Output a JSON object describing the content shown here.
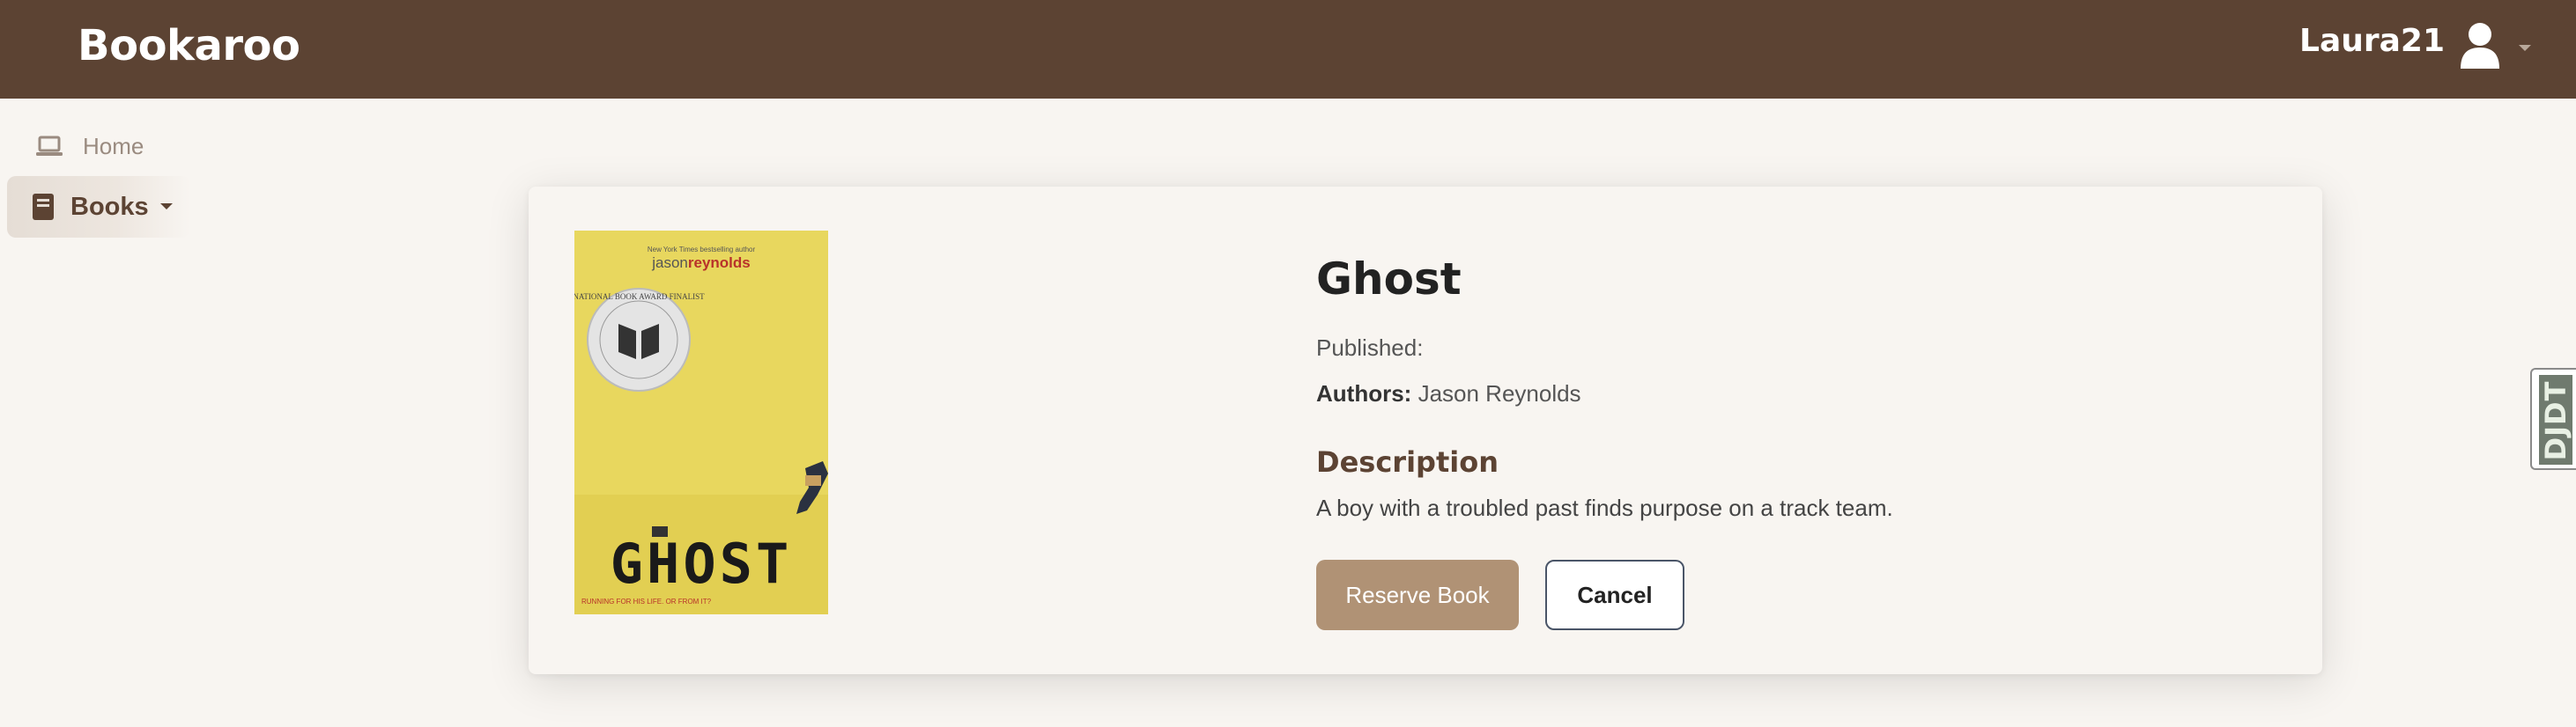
{
  "header": {
    "brand": "Bookaroo",
    "username": "Laura21",
    "avatar_icon": "user-icon",
    "menu_icon": "caret-down-icon"
  },
  "sidebar": {
    "items": [
      {
        "label": "Home",
        "icon": "laptop-icon"
      },
      {
        "label": "Books",
        "icon": "book-icon",
        "active": true
      }
    ]
  },
  "book": {
    "title": "Ghost",
    "published_label": "Published:",
    "published_value": "",
    "authors_label": "Authors:",
    "authors_value": "Jason Reynolds",
    "description_heading": "Description",
    "description": "A boy with a troubled past finds purpose on a track team.",
    "cover": {
      "tagline": "New York Times bestselling author",
      "author_first": "jason",
      "author_last": "reynolds",
      "seal_text": "NATIONAL BOOK AWARD FINALIST",
      "title": "GHOST",
      "subtitle": "RUNNING FOR HIS LIFE. OR FROM IT?"
    }
  },
  "actions": {
    "reserve_label": "Reserve Book",
    "cancel_label": "Cancel"
  },
  "debug_toolbar": {
    "label": "DJDT"
  },
  "colors": {
    "header_bg": "#5c4333",
    "page_bg": "#f8f5f1",
    "primary_button": "#b09275",
    "cover_yellow": "#e8d75e"
  }
}
